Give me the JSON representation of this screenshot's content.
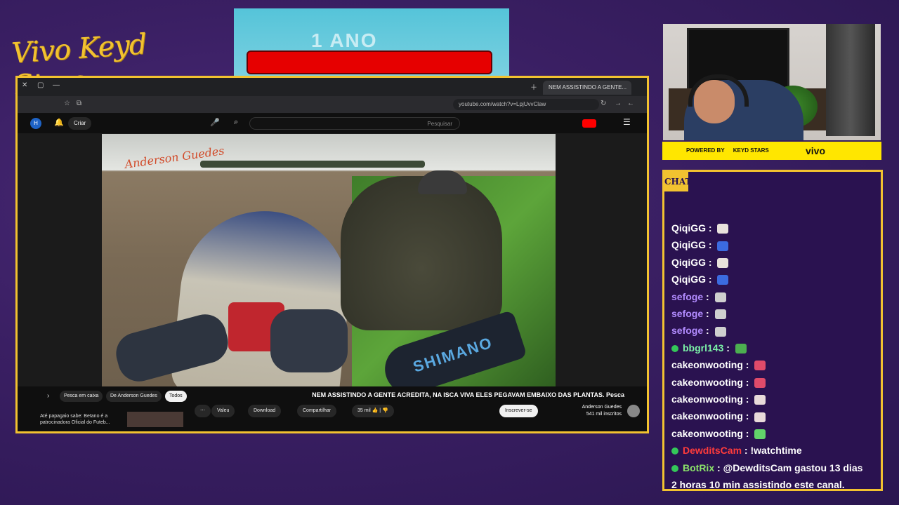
{
  "overlay": {
    "brand": "Vivo Keyd Stars",
    "ad_text": "1 ANO",
    "powered_by": "POWERED BY",
    "sponsor_a": "KEYD STARS",
    "sponsor_b": "vivo",
    "chat_label": "CHAT"
  },
  "browser": {
    "tab_title": "NEM ASSISTINDO A GENTE...",
    "url": "youtube.com/watch?v=LpjUvvClaw",
    "search_placeholder": "Pesquisar",
    "create_label": "Criar"
  },
  "video": {
    "watermark": "Anderson Guedes",
    "paddle_brand": "SHIMANO",
    "title": "NEM ASSISTINDO A GENTE ACREDITA, NA ISCA VIVA ELES PEGAVAM EMBAIXO DAS PLANTAS. Pesca",
    "channel": "Anderson Guedes",
    "subscribers": "541 mil inscritos",
    "subscribe_label": "Inscrever-se",
    "likes": "35 mil",
    "share_label": "Compartilhar",
    "download_label": "Download",
    "thanks_label": "Valeu",
    "chips": [
      "Todos",
      "De Anderson Guedes",
      "Pesca em caixa"
    ],
    "rec_text": "Até papagaio sabe: Betano é a patrocinadora Oficial do Futeb..."
  },
  "chat": {
    "messages": [
      {
        "user": "QiqiGG",
        "color": "#ffffff",
        "emoji": "#e8e2dc",
        "text": ""
      },
      {
        "user": "QiqiGG",
        "color": "#ffffff",
        "emoji": "#3b6be0",
        "text": ""
      },
      {
        "user": "QiqiGG",
        "color": "#ffffff",
        "emoji": "#e8e2dc",
        "text": ""
      },
      {
        "user": "QiqiGG",
        "color": "#ffffff",
        "emoji": "#3b6be0",
        "text": ""
      },
      {
        "user": "sefoge",
        "color": "#b28cff",
        "emoji": "#cfcfcf",
        "text": ""
      },
      {
        "user": "sefoge",
        "color": "#b28cff",
        "emoji": "#cfcfcf",
        "text": ""
      },
      {
        "user": "sefoge",
        "color": "#b28cff",
        "emoji": "#cfcfcf",
        "text": ""
      },
      {
        "user": "bbgrl143",
        "color": "#7cf3a8",
        "emoji": "#4caf50",
        "text": ""
      },
      {
        "user": "cakeonwooting",
        "color": "#ffffff",
        "emoji": "#e04b6a",
        "text": ""
      },
      {
        "user": "cakeonwooting",
        "color": "#ffffff",
        "emoji": "#e04b6a",
        "text": ""
      },
      {
        "user": "cakeonwooting",
        "color": "#ffffff",
        "emoji": "#e8dada",
        "text": ""
      },
      {
        "user": "cakeonwooting",
        "color": "#ffffff",
        "emoji": "#e8dada",
        "text": ""
      },
      {
        "user": "cakeonwooting",
        "color": "#ffffff",
        "emoji": "#62d36a",
        "text": ""
      },
      {
        "user": "DewditsCam",
        "color": "#ff3b3b",
        "emoji": "",
        "text": "!watchtime"
      },
      {
        "user": "BotRix",
        "color": "#8be36a",
        "emoji": "",
        "text": "@DewditsCam gastou 13 dias"
      },
      {
        "user": "",
        "color": "#ffffff",
        "emoji": "",
        "text": "2 horas 10 min assistindo este canal."
      }
    ]
  }
}
